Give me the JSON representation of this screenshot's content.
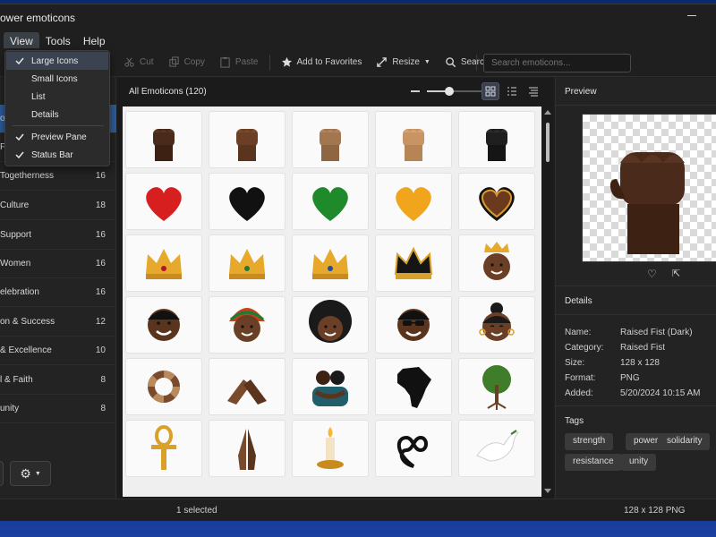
{
  "window": {
    "title": "ower emoticons"
  },
  "menu": [
    "View",
    "Tools",
    "Help"
  ],
  "view_menu": {
    "items": [
      {
        "label": "Large Icons",
        "checked": true
      },
      {
        "label": "Small Icons",
        "checked": false
      },
      {
        "label": "List",
        "checked": false
      },
      {
        "label": "Details",
        "checked": false
      },
      {
        "label": "Preview Pane",
        "checked": true
      },
      {
        "label": "Status Bar",
        "checked": true
      }
    ]
  },
  "toolbar": {
    "cut": "Cut",
    "copy": "Copy",
    "paste": "Paste",
    "add_favorites": "Add to Favorites",
    "resize": "Resize",
    "search_btn": "Search",
    "search_placeholder": "Search emoticons..."
  },
  "sidebar": {
    "categories": [
      {
        "label": "ot",
        "count": ""
      },
      {
        "label": "F",
        "count": ""
      },
      {
        "label": "Togetherness",
        "count": "16"
      },
      {
        "label": "Culture",
        "count": "18"
      },
      {
        "label": "Support",
        "count": "16"
      },
      {
        "label": "Women",
        "count": "16"
      },
      {
        "label": "elebration",
        "count": "16"
      },
      {
        "label": "on & Success",
        "count": "12"
      },
      {
        "label": "& Excellence",
        "count": "10"
      },
      {
        "label": "l & Faith",
        "count": "8"
      },
      {
        "label": "unity",
        "count": "8"
      }
    ]
  },
  "main": {
    "header": "All Emoticons (120)"
  },
  "emoticons": [
    "raised-fist-dark",
    "raised-fist-medium-dark",
    "raised-fist-medium",
    "raised-fist-medium-light",
    "raised-fist-black",
    "red-heart",
    "black-heart",
    "green-heart",
    "gold-heart",
    "brown-heart",
    "gold-crown-ruby",
    "gold-crown-green",
    "gold-crown-blue",
    "black-gold-crown",
    "queen-with-crown",
    "man-smiling",
    "woman-headwrap",
    "woman-afro",
    "man-sunglasses",
    "woman-hoops",
    "circle-of-hands",
    "clasped-hands",
    "hug",
    "africa-map",
    "tree-of-life",
    "ankh",
    "praying-hands",
    "candle",
    "infinity-heart",
    "dove"
  ],
  "preview": {
    "title": "Preview"
  },
  "details": {
    "title": "Details",
    "rows": [
      {
        "k": "Name:",
        "v": "Raised Fist (Dark)"
      },
      {
        "k": "Category:",
        "v": "Raised Fist"
      },
      {
        "k": "Size:",
        "v": "128 x 128"
      },
      {
        "k": "Format:",
        "v": "PNG"
      },
      {
        "k": "Added:",
        "v": "5/20/2024  10:15 AM"
      }
    ]
  },
  "tags": {
    "title": "Tags",
    "items": [
      "strength",
      "power",
      "solidarity",
      "resistance",
      "unity"
    ]
  },
  "status": {
    "left": "1 selected",
    "right": "128 x 128 PNG"
  },
  "colors": {
    "accent": "#2e5c9a",
    "window_bg": "#202020",
    "selection": "#3b4250"
  }
}
